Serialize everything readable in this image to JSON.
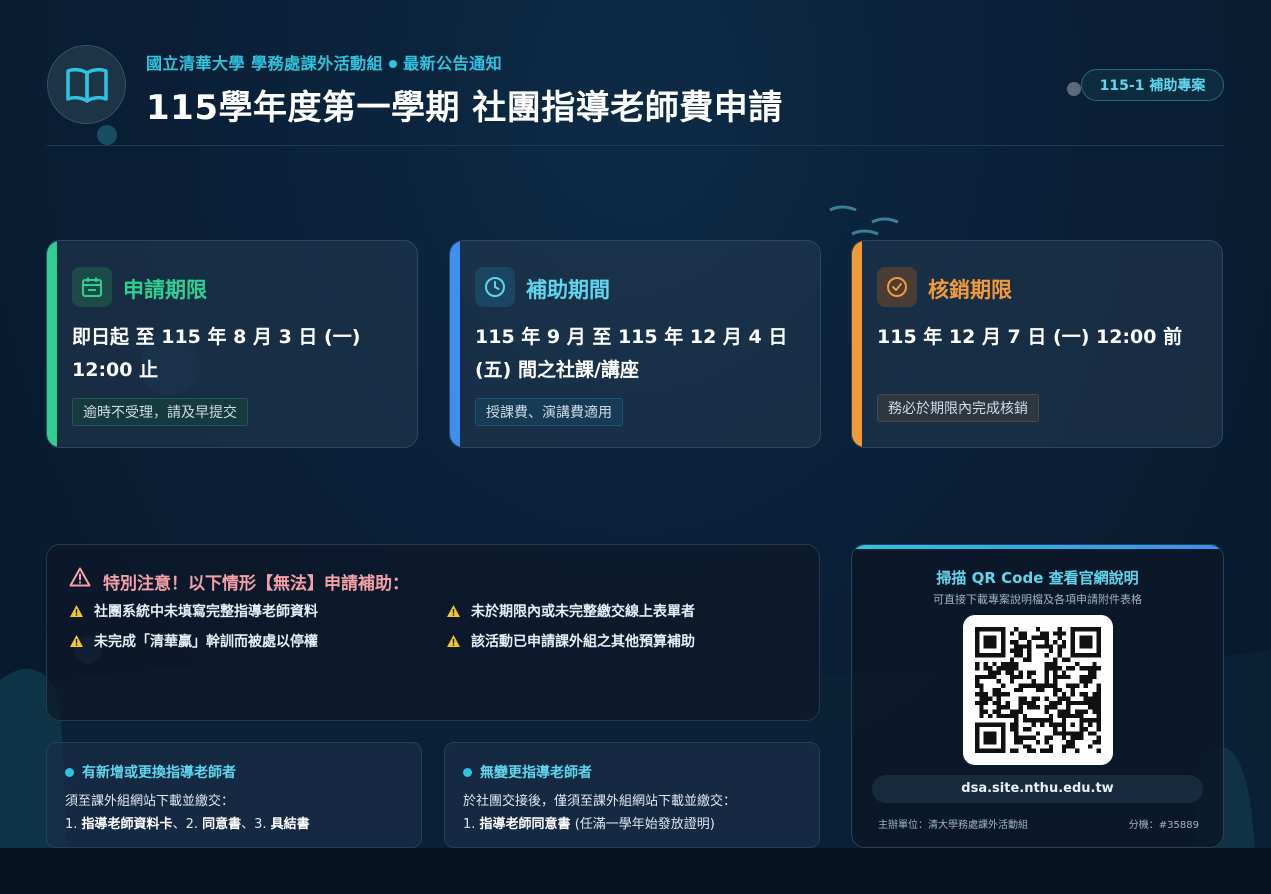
{
  "header": {
    "subtitle_org": "國立清華大學 學務處課外活動組",
    "subtitle_tag": "最新公告通知",
    "title": "115學年度第一學期 社團指導老師費申請",
    "badge": "115-1 補助專案"
  },
  "cards": [
    {
      "title": "申請期限",
      "body": "即日起 至 115 年 8 月 3 日 (一) 12:00 止",
      "tag": "逾時不受理，請及早提交",
      "accent": "#2fcf8f",
      "icon": "calendar-icon"
    },
    {
      "title": "補助期間",
      "body": "115 年 9 月 至 115 年 12 月 4 日 (五) 間之社課/講座",
      "tag": "授課費、演講費適用",
      "accent": "#3f8ef0",
      "icon": "clock-icon"
    },
    {
      "title": "核銷期限",
      "body": "115 年 12 月 7 日 (一) 12:00 前",
      "tag": "務必於期限內完成核銷",
      "accent": "#f29a3a",
      "icon": "check-circle-icon"
    }
  ],
  "warning": {
    "title": "特別注意！以下情形【無法】申請補助：",
    "items": [
      "社團系統中未填寫完整指導老師資料",
      "未於期限內或未完整繳交線上表單者",
      "未完成「清華贏」幹訓而被處以停權",
      "該活動已申請課外組之其他預算補助"
    ]
  },
  "new_advisor": {
    "title": "有新增或更換指導老師者",
    "line1": "須至課外組網站下載並繳交：",
    "l2_a": "1. ",
    "l2_b": "指導老師資料卡",
    "l2_c": "、2. ",
    "l2_d": "同意書",
    "l2_e": "、3. ",
    "l2_f": "具結書"
  },
  "same_advisor": {
    "title": "無變更指導老師者",
    "line1": "於社團交接後，僅須至課外組網站下載並繳交：",
    "l2_a": "1. ",
    "l2_b": "指導老師同意書",
    "l2_c": " (任滿一學年始發放證明)"
  },
  "qr": {
    "title": "掃描 QR Code 查看官網說明",
    "subtitle": "可直接下載專案說明檔及各項申請附件表格",
    "url": "dsa.site.nthu.edu.tw",
    "organizer": "主辦單位：清大學務處課外活動組",
    "extension": "分機：#35889"
  },
  "colors": {
    "accent": "#2ec4e0",
    "warning_title": "#f4a0a8",
    "background": "#08192b"
  }
}
